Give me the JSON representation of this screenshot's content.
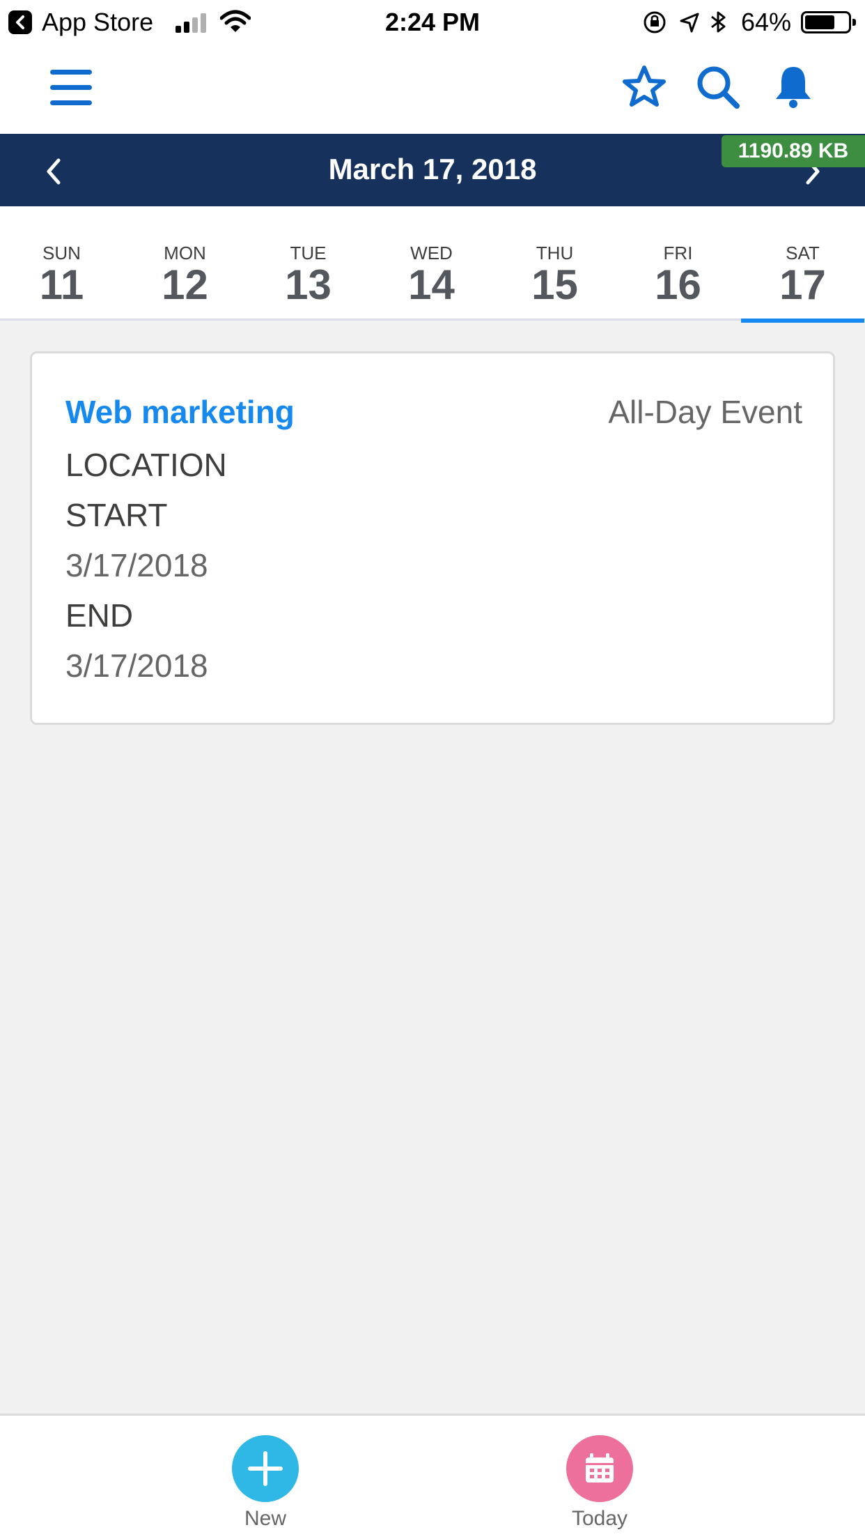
{
  "status_bar": {
    "back_app": "App Store",
    "time": "2:24 PM",
    "battery_percent": "64%"
  },
  "header": {
    "icons": [
      "menu-icon",
      "star-icon",
      "search-icon",
      "bell-icon"
    ]
  },
  "date_nav": {
    "title": "March 17, 2018",
    "size_badge": "1190.89 KB"
  },
  "week": {
    "days": [
      {
        "dow": "SUN",
        "num": "11"
      },
      {
        "dow": "MON",
        "num": "12"
      },
      {
        "dow": "TUE",
        "num": "13"
      },
      {
        "dow": "WED",
        "num": "14"
      },
      {
        "dow": "THU",
        "num": "15"
      },
      {
        "dow": "FRI",
        "num": "16"
      },
      {
        "dow": "SAT",
        "num": "17"
      }
    ],
    "selected": "SAT"
  },
  "event": {
    "title": "Web marketing",
    "all_day": "All-Day Event",
    "location_label": "LOCATION",
    "start_label": "START",
    "start_value": "3/17/2018",
    "end_label": "END",
    "end_value": "3/17/2018"
  },
  "bottom_bar": {
    "new_label": "New",
    "today_label": "Today"
  },
  "colors": {
    "brand_blue": "#0f6bce",
    "nav_dark": "#16325c",
    "badge_green": "#3e8e41",
    "new_button": "#2fb8e6",
    "today_button": "#ec6f9c"
  }
}
